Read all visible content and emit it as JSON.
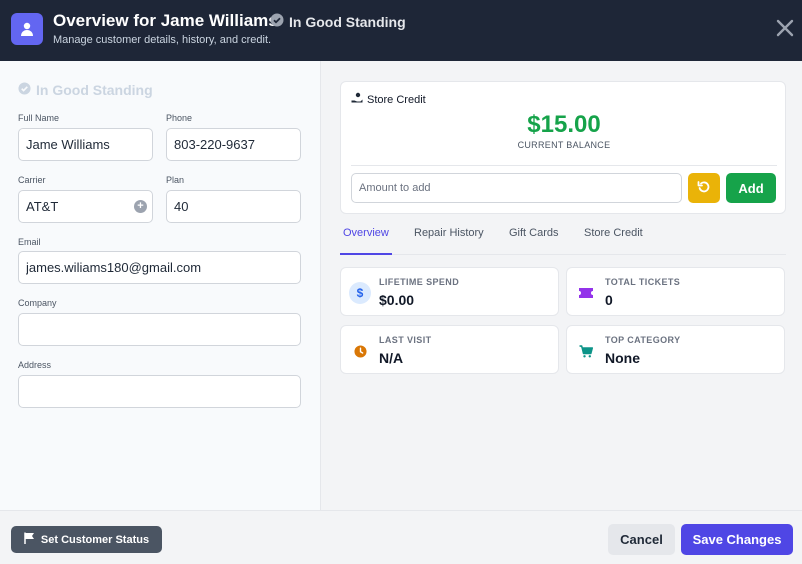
{
  "header": {
    "title": "Overview for Jame Williams",
    "badge": "In Good Standing",
    "subtitle": "Manage customer details, history, and credit.",
    "icons": {
      "avatar": "user-icon",
      "badge": "check-circle-icon",
      "close": "close-icon"
    }
  },
  "customer": {
    "status": "In Good Standing",
    "full_name_label": "Full Name",
    "full_name": "Jame Williams",
    "phone_label": "Phone",
    "phone": "803-220-9637",
    "carrier_label": "Carrier",
    "carrier": "AT&T",
    "plan_label": "Plan",
    "plan": "40",
    "email_label": "Email",
    "email": "james.wiliams180@gmail.com",
    "company_label": "Company",
    "company": "",
    "address_label": "Address",
    "address": ""
  },
  "store_credit": {
    "heading": "Store Credit",
    "amount": "$15.00",
    "balance_label": "CURRENT BALANCE",
    "amount_placeholder": "Amount to add",
    "add_label": "Add",
    "icons": {
      "heading": "hand-coin-icon",
      "reset": "undo-icon"
    }
  },
  "tabs": [
    {
      "label": "Overview",
      "active": true
    },
    {
      "label": "Repair History",
      "active": false
    },
    {
      "label": "Gift Cards",
      "active": false
    },
    {
      "label": "Store Credit",
      "active": false
    }
  ],
  "stats": [
    {
      "label": "LIFETIME SPEND",
      "value": "$0.00",
      "icon": "dollar-icon",
      "color": "#2563eb"
    },
    {
      "label": "TOTAL TICKETS",
      "value": "0",
      "icon": "ticket-icon",
      "color": "#9333ea"
    },
    {
      "label": "LAST VISIT",
      "value": "N/A",
      "icon": "clock-icon",
      "color": "#d97706"
    },
    {
      "label": "TOP CATEGORY",
      "value": "None",
      "icon": "cart-icon",
      "color": "#0d9488"
    }
  ],
  "footer": {
    "status_button": "Set Customer Status",
    "cancel": "Cancel",
    "save": "Save Changes"
  },
  "colors": {
    "header_bg": "#1e2637",
    "accent": "#4f46e5",
    "credit_green": "#16a34a",
    "reset_yellow": "#eab308"
  }
}
